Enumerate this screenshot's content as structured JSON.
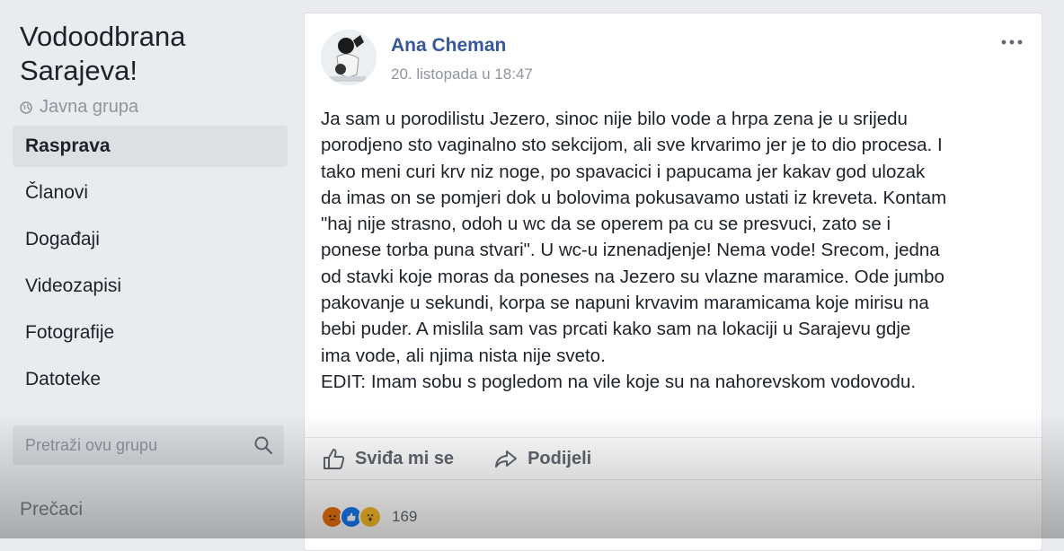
{
  "sidebar": {
    "group_title": "Vodoodbrana Sarajeva!",
    "group_type": "Javna grupa",
    "nav_items": [
      {
        "label": "Rasprava",
        "active": true
      },
      {
        "label": "Članovi"
      },
      {
        "label": "Događaji"
      },
      {
        "label": "Videozapisi"
      },
      {
        "label": "Fotografije"
      },
      {
        "label": "Datoteke"
      }
    ],
    "search_placeholder": "Pretraži ovu grupu",
    "shortcuts_label": "Prečaci"
  },
  "post": {
    "author": "Ana Cheman",
    "timestamp": "20. listopada u 18:47",
    "lines": [
      "Ja sam u porodilistu Jezero, sinoc nije bilo vode a hrpa zena je u srijedu",
      "porodjeno sto vaginalno sto sekcijom, ali sve krvarimo jer je to dio procesa. I",
      "tako meni curi krv niz noge, po spavacici i papucama jer kakav god ulozak",
      "da imas on se pomjeri dok u bolovima pokusavamo ustati iz kreveta. Kontam",
      "\"haj nije strasno, odoh u wc da se operem pa cu se presvuci, zato se i",
      "ponese torba puna stvari\". U wc-u iznenadjenje! Nema vode! Srecom, jedna",
      "od stavki koje moras da poneses na Jezero su vlazne maramice. Ode jumbo",
      "pakovanje u sekundi, korpa se napuni krvavim maramicama koje mirisu na",
      "bebi puder. A mislila sam vas prcati kako sam na lokaciji u Sarajevu gdje",
      "ima vode, ali njima nista nije sveto.",
      "EDIT: Imam sobu s pogledom na vile koje su na nahorevskom vodovodu."
    ],
    "like_label": "Sviđa mi se",
    "share_label": "Podijeli",
    "reaction_count": "169",
    "colors": {
      "link": "#385898",
      "angry": "#e9710f",
      "like": "#1877f2",
      "wow": "#f7b928"
    }
  }
}
